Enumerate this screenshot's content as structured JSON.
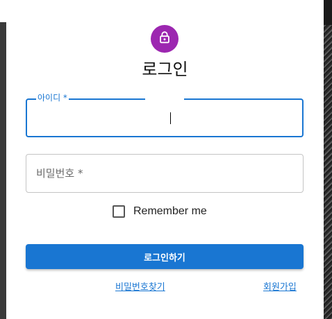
{
  "colors": {
    "accent": "#1976d2",
    "avatar_bg": "#9c27b0"
  },
  "header": {
    "icon": "lock-icon",
    "title": "로그인"
  },
  "form": {
    "id_field": {
      "label": "아이디 *",
      "value": ""
    },
    "password_field": {
      "label": "비밀번호 *",
      "value": ""
    },
    "remember": {
      "label": "Remember me",
      "checked": false
    },
    "submit_label": "로그인하기"
  },
  "links": {
    "find_password": "비밀번호찾기",
    "signup": "회원가입"
  }
}
